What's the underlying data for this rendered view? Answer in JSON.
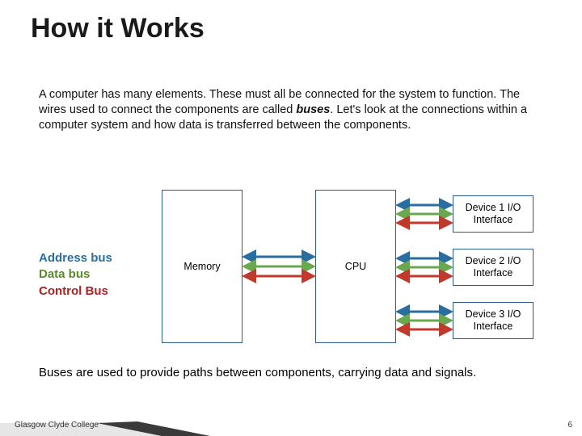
{
  "title": "How it Works",
  "intro": {
    "p1a": "A computer has many elements. These must all be connected for the system to function.  The wires used to connect the components are called ",
    "buses_word": "buses",
    "p1b": ". Let's look at  the connections within a computer system and how data is transferred between the components."
  },
  "legend": {
    "address": "Address bus",
    "data": "Data bus",
    "control": "Control Bus"
  },
  "blocks": {
    "memory": "Memory",
    "cpu": "CPU",
    "device1": "Device 1 I/O Interface",
    "device2": "Device 2 I/O Interface",
    "device3": "Device 3 I/O Interface"
  },
  "outro": "Buses are used to provide paths between components, carrying data and signals.",
  "footer": "Glasgow Clyde College",
  "page_number": "6",
  "colors": {
    "address": "#2a6ea1",
    "data": "#6aa84f",
    "control": "#c0392b",
    "box_border": "#2a5b8c"
  }
}
